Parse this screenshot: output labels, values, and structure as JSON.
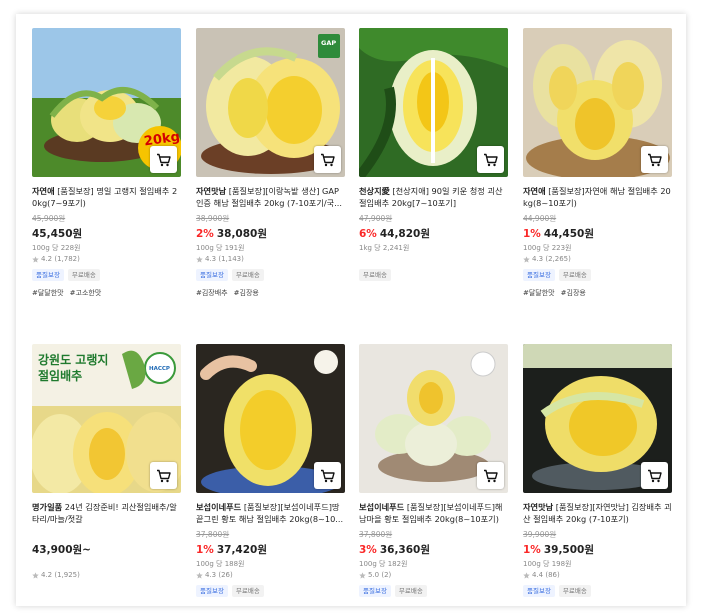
{
  "products": [
    {
      "brand": "자연애",
      "title": "[품질보장] 명일 고랭지 절임배추 20kg(7~9포기)",
      "original_price": "45,900원",
      "discount": "",
      "price": "45,450원",
      "unit_price": "100g 당 228원",
      "rating": "4.2 (1,782)",
      "badges": [
        "품질보장",
        "무료배송"
      ],
      "tags": [
        "#달달한맛",
        "#고소한맛"
      ],
      "image_text": "20kg",
      "cart_icon": "cart-icon"
    },
    {
      "brand": "자연맛남",
      "title": "[품질보장][이랑녹밭 생산] GAP 인증 해남 절임배추 20kg (7-10포기/국...",
      "original_price": "38,900원",
      "discount": "2%",
      "price": "38,080원",
      "unit_price": "100g 당 191원",
      "rating": "4.3 (1,143)",
      "badges": [
        "품질보장",
        "무료배송"
      ],
      "tags": [
        "#김장배추",
        "#김장용"
      ],
      "image_text": "GAP",
      "cart_icon": "cart-icon"
    },
    {
      "brand": "천상지愛",
      "title": "[천상지애] 90일 키운 청정 괴산 절임배추 20kg[7~10포기]",
      "original_price": "47,900원",
      "discount": "6%",
      "price": "44,820원",
      "unit_price": "1kg 당 2,241원",
      "rating": "",
      "badges": [
        "무료배송"
      ],
      "tags": [],
      "image_text": "",
      "cart_icon": "cart-icon"
    },
    {
      "brand": "자연애",
      "title": "[품질보장]자연애 해남 절임배추 20kg(8~10포기)",
      "original_price": "44,900원",
      "discount": "1%",
      "price": "44,450원",
      "unit_price": "100g 당 223원",
      "rating": "4.3 (2,265)",
      "badges": [
        "품질보장",
        "무료배송"
      ],
      "tags": [
        "#달달한맛",
        "#김장용"
      ],
      "image_text": "",
      "cart_icon": "cart-icon"
    },
    {
      "brand": "명가일품",
      "title": "24년 김장준비! 괴산절임배추/알타리/마늘/젓갈",
      "original_price": "",
      "discount": "",
      "price": "43,900원~",
      "unit_price": "",
      "rating": "4.2 (1,925)",
      "badges": [],
      "tags": [],
      "image_text": "강원도 고랭지 절임배추",
      "image_badge": "HACCP",
      "cart_icon": "cart-icon"
    },
    {
      "brand": "보섭이네푸드",
      "title": "[품질보장][보섭이네푸드]땅끝그린 황토 해남 절임배추 20kg(8~10...",
      "original_price": "37,800원",
      "discount": "1%",
      "price": "37,420원",
      "unit_price": "100g 당 188원",
      "rating": "4.3 (26)",
      "badges": [
        "품질보장",
        "무료배송"
      ],
      "tags": [],
      "image_text": "",
      "cart_icon": "cart-icon"
    },
    {
      "brand": "보섭이네푸드",
      "title": "[품질보장][보섭이네푸드]해남마을 황토 절임배추 20kg(8~10포기)",
      "original_price": "37,800원",
      "discount": "3%",
      "price": "36,360원",
      "unit_price": "100g 당 182원",
      "rating": "5.0 (2)",
      "badges": [
        "품질보장",
        "무료배송"
      ],
      "tags": [],
      "image_text": "",
      "cart_icon": "cart-icon"
    },
    {
      "brand": "자연맛남",
      "title": "[품질보장][자연맛남] 김장배추 괴산 절임배추 20kg (7-10포기)",
      "original_price": "39,900원",
      "discount": "1%",
      "price": "39,500원",
      "unit_price": "100g 당 198원",
      "rating": "4.4 (86)",
      "badges": [
        "품질보장",
        "무료배송"
      ],
      "tags": [],
      "image_text": "",
      "cart_icon": "cart-icon"
    }
  ],
  "colors": {
    "discount": "#fa2828",
    "quality_badge": "#3b6fe0",
    "star": "#bbbbbb"
  }
}
